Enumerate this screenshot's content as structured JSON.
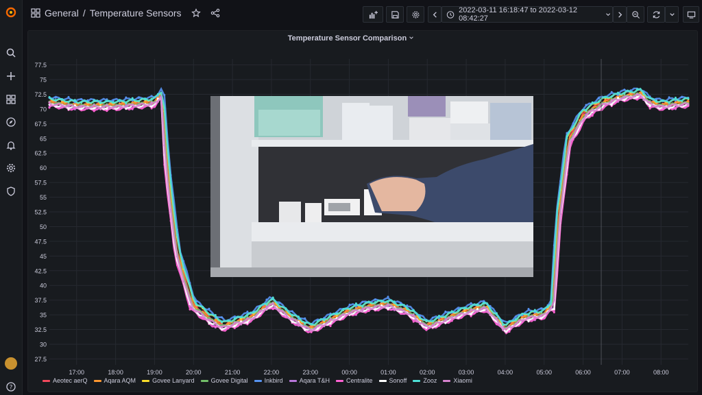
{
  "breadcrumb": {
    "folder": "General",
    "separator": "/",
    "dashboard": "Temperature Sensors"
  },
  "time_range": {
    "label": "2022-03-11 16:18:47 to 2022-03-12 08:42:27"
  },
  "panel": {
    "title": "Temperature Sensor Comparison"
  },
  "icons": {
    "sidebar": [
      "grafana-logo-icon",
      "search-icon",
      "plus-icon",
      "dashboards-icon",
      "explore-icon",
      "alerting-icon",
      "gear-icon",
      "shield-icon",
      "help-icon"
    ],
    "toolbar": [
      "add-panel-icon",
      "save-icon",
      "gear-icon",
      "chevron-left-icon",
      "clock-icon",
      "chevron-down-icon",
      "chevron-right-icon",
      "zoom-out-icon",
      "refresh-icon",
      "chevron-down-icon",
      "tv-icon"
    ]
  },
  "chart_data": {
    "type": "line",
    "x_ticks": [
      "17:00",
      "18:00",
      "19:00",
      "20:00",
      "21:00",
      "22:00",
      "23:00",
      "00:00",
      "01:00",
      "02:00",
      "03:00",
      "04:00",
      "05:00",
      "06:00",
      "07:00",
      "08:00"
    ],
    "x_range_hours": [
      16.3,
      32.7
    ],
    "y_ticks": [
      "27.5",
      "30",
      "32.5",
      "35",
      "37.5",
      "40",
      "42.5",
      "45",
      "47.5",
      "50",
      "52.5",
      "55",
      "57.5",
      "60",
      "62.5",
      "65",
      "67.5",
      "70",
      "72.5",
      "75",
      "77.5"
    ],
    "ylim": [
      26.5,
      78.5
    ],
    "grid": true,
    "legend_position": "bottom-left",
    "base_profile_x": [
      16.3,
      17.0,
      18.0,
      19.0,
      19.2,
      19.35,
      19.6,
      20.0,
      20.5,
      20.8,
      21.5,
      22.0,
      22.5,
      23.0,
      23.5,
      24.0,
      24.5,
      25.0,
      25.5,
      26.0,
      26.5,
      27.0,
      27.5,
      28.0,
      28.5,
      29.0,
      29.2,
      29.35,
      29.6,
      30.0,
      30.5,
      31.0,
      31.5,
      31.7,
      32.0,
      32.7
    ],
    "base_profile_y": [
      71.5,
      71.0,
      71.0,
      71.5,
      73.0,
      60.0,
      46.0,
      37.0,
      34.5,
      33.5,
      35.0,
      37.5,
      35.0,
      33.0,
      34.5,
      36.0,
      36.8,
      37.2,
      36.0,
      33.5,
      34.8,
      36.0,
      36.8,
      33.0,
      35.0,
      35.5,
      37.0,
      52.0,
      65.0,
      69.5,
      71.5,
      72.5,
      73.0,
      71.5,
      71.0,
      71.5
    ],
    "series": [
      {
        "name": "Aeotec aerQ",
        "color": "#f2495c",
        "offset": -0.3
      },
      {
        "name": "Aqara AQM",
        "color": "#ff9830",
        "offset": -0.5
      },
      {
        "name": "Govee Lanyard",
        "color": "#fade2a",
        "offset": 0.2
      },
      {
        "name": "Govee Digital",
        "color": "#73bf69",
        "offset": -0.6
      },
      {
        "name": "Inkbird",
        "color": "#5794f2",
        "offset": 0.6
      },
      {
        "name": "Aqara T&H",
        "color": "#b877d9",
        "offset": -1.1
      },
      {
        "name": "Centralite",
        "color": "#ff62d3",
        "offset": -1.3
      },
      {
        "name": "Sonoff",
        "color": "#ffffff",
        "offset": -1.0
      },
      {
        "name": "Zooz",
        "color": "#4ee0d6",
        "offset": 0.3
      },
      {
        "name": "Xiaomi",
        "color": "#d683ce",
        "offset": -0.8
      }
    ]
  }
}
